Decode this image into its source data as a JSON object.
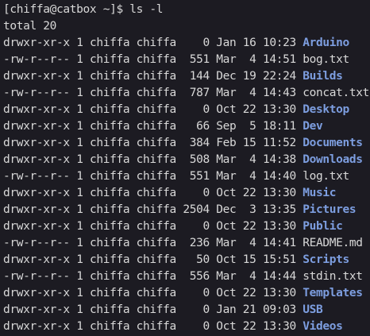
{
  "terminal": {
    "prompt": "[chiffa@catbox ~]$ ",
    "command": "ls -l",
    "total": "total 20",
    "colors": {
      "background": "#1c1b22",
      "foreground": "#d8d8d8",
      "directory": "#7d9ee0"
    },
    "entries": [
      {
        "perms": "drwxr-xr-x",
        "links": "1",
        "user": "chiffa",
        "group": "chiffa",
        "size": "0",
        "month": "Jan",
        "day": "16",
        "time": "10:23",
        "name": "Arduino",
        "is_dir": true
      },
      {
        "perms": "-rw-r--r--",
        "links": "1",
        "user": "chiffa",
        "group": "chiffa",
        "size": "551",
        "month": "Mar",
        "day": "4",
        "time": "14:51",
        "name": "bog.txt",
        "is_dir": false
      },
      {
        "perms": "drwxr-xr-x",
        "links": "1",
        "user": "chiffa",
        "group": "chiffa",
        "size": "144",
        "month": "Dec",
        "day": "19",
        "time": "22:24",
        "name": "Builds",
        "is_dir": true
      },
      {
        "perms": "-rw-r--r--",
        "links": "1",
        "user": "chiffa",
        "group": "chiffa",
        "size": "787",
        "month": "Mar",
        "day": "4",
        "time": "14:43",
        "name": "concat.txt",
        "is_dir": false
      },
      {
        "perms": "drwxr-xr-x",
        "links": "1",
        "user": "chiffa",
        "group": "chiffa",
        "size": "0",
        "month": "Oct",
        "day": "22",
        "time": "13:30",
        "name": "Desktop",
        "is_dir": true
      },
      {
        "perms": "drwxr-xr-x",
        "links": "1",
        "user": "chiffa",
        "group": "chiffa",
        "size": "66",
        "month": "Sep",
        "day": "5",
        "time": "18:11",
        "name": "Dev",
        "is_dir": true
      },
      {
        "perms": "drwxr-xr-x",
        "links": "1",
        "user": "chiffa",
        "group": "chiffa",
        "size": "384",
        "month": "Feb",
        "day": "15",
        "time": "11:52",
        "name": "Documents",
        "is_dir": true
      },
      {
        "perms": "drwxr-xr-x",
        "links": "1",
        "user": "chiffa",
        "group": "chiffa",
        "size": "508",
        "month": "Mar",
        "day": "4",
        "time": "14:38",
        "name": "Downloads",
        "is_dir": true
      },
      {
        "perms": "-rw-r--r--",
        "links": "1",
        "user": "chiffa",
        "group": "chiffa",
        "size": "551",
        "month": "Mar",
        "day": "4",
        "time": "14:40",
        "name": "log.txt",
        "is_dir": false
      },
      {
        "perms": "drwxr-xr-x",
        "links": "1",
        "user": "chiffa",
        "group": "chiffa",
        "size": "0",
        "month": "Oct",
        "day": "22",
        "time": "13:30",
        "name": "Music",
        "is_dir": true
      },
      {
        "perms": "drwxr-xr-x",
        "links": "1",
        "user": "chiffa",
        "group": "chiffa",
        "size": "2504",
        "month": "Dec",
        "day": "3",
        "time": "13:35",
        "name": "Pictures",
        "is_dir": true
      },
      {
        "perms": "drwxr-xr-x",
        "links": "1",
        "user": "chiffa",
        "group": "chiffa",
        "size": "0",
        "month": "Oct",
        "day": "22",
        "time": "13:30",
        "name": "Public",
        "is_dir": true
      },
      {
        "perms": "-rw-r--r--",
        "links": "1",
        "user": "chiffa",
        "group": "chiffa",
        "size": "236",
        "month": "Mar",
        "day": "4",
        "time": "14:41",
        "name": "README.md",
        "is_dir": false
      },
      {
        "perms": "drwxr-xr-x",
        "links": "1",
        "user": "chiffa",
        "group": "chiffa",
        "size": "50",
        "month": "Oct",
        "day": "15",
        "time": "15:51",
        "name": "Scripts",
        "is_dir": true
      },
      {
        "perms": "-rw-r--r--",
        "links": "1",
        "user": "chiffa",
        "group": "chiffa",
        "size": "556",
        "month": "Mar",
        "day": "4",
        "time": "14:44",
        "name": "stdin.txt",
        "is_dir": false
      },
      {
        "perms": "drwxr-xr-x",
        "links": "1",
        "user": "chiffa",
        "group": "chiffa",
        "size": "0",
        "month": "Oct",
        "day": "22",
        "time": "13:30",
        "name": "Templates",
        "is_dir": true
      },
      {
        "perms": "drwxr-xr-x",
        "links": "1",
        "user": "chiffa",
        "group": "chiffa",
        "size": "0",
        "month": "Jan",
        "day": "21",
        "time": "09:03",
        "name": "USB",
        "is_dir": true
      },
      {
        "perms": "drwxr-xr-x",
        "links": "1",
        "user": "chiffa",
        "group": "chiffa",
        "size": "0",
        "month": "Oct",
        "day": "22",
        "time": "13:30",
        "name": "Videos",
        "is_dir": true
      }
    ]
  }
}
